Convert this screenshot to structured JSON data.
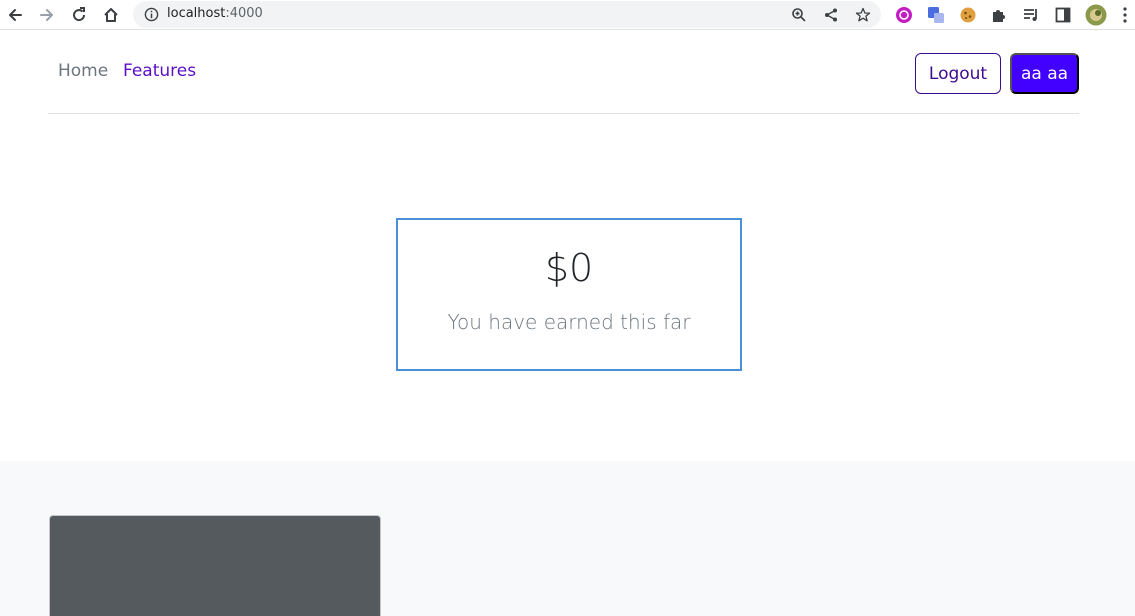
{
  "browser": {
    "url_host": "localhost",
    "url_port": ":4000",
    "icons": {
      "back": "back-arrow-icon",
      "forward": "forward-arrow-icon",
      "reload": "reload-icon",
      "home": "home-icon",
      "site_info": "info-icon",
      "zoom": "zoom-icon",
      "share": "share-icon",
      "bookmark": "star-icon"
    }
  },
  "nav": {
    "home_label": "Home",
    "features_label": "Features",
    "logout_label": "Logout",
    "user_label": "aa aa"
  },
  "earnings": {
    "amount": "$0",
    "caption": "You have earned this far"
  },
  "colors": {
    "primary": "#4200ff",
    "nav_active": "#5a0fc8",
    "card_border": "#4a90d9"
  }
}
